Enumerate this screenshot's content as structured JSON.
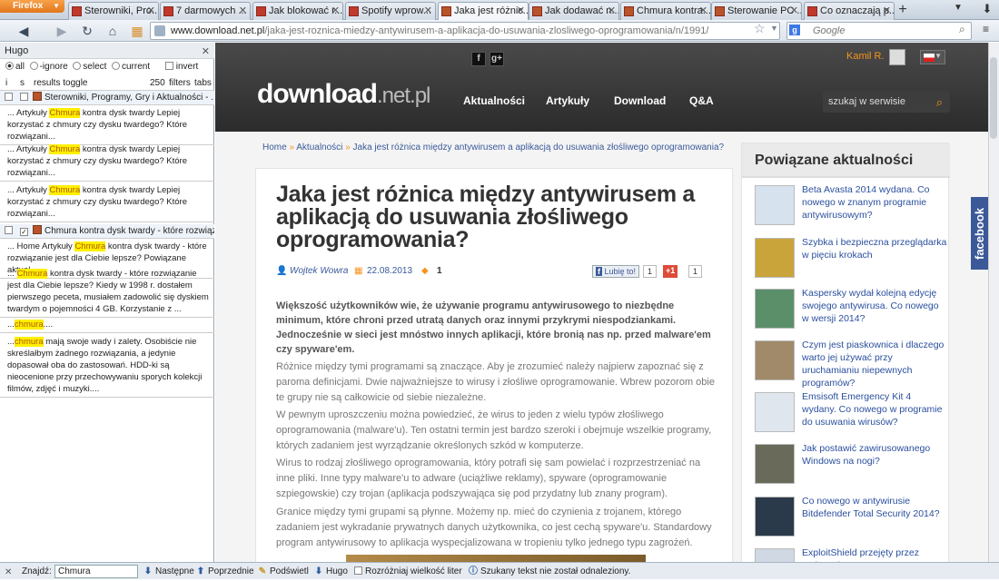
{
  "browser": {
    "menu_button": "Firefox",
    "tabs": [
      {
        "title": "Sterowniki, Pro...",
        "active": false
      },
      {
        "title": "7 darmowych ...",
        "active": false
      },
      {
        "title": "Jak blokować r...",
        "active": false
      },
      {
        "title": "Spotify wprow...",
        "active": false
      },
      {
        "title": "Jaka jest różnic...",
        "active": true
      },
      {
        "title": "Jak dodawać n...",
        "active": false
      },
      {
        "title": "Chmura kontra...",
        "active": false
      },
      {
        "title": "Sterowanie PC ...",
        "active": false
      },
      {
        "title": "Co oznaczają p...",
        "active": false
      }
    ],
    "url_domain": "www.download.net.pl",
    "url_path": "/jaka-jest-roznica-miedzy-antywirusem-a-aplikacja-do-usuwania-zlosliwego-oprogramowania/n/1991/",
    "search_placeholder": "Google"
  },
  "sidebar": {
    "title": "Hugo",
    "radios": [
      "all",
      "-ignore",
      "select",
      "current"
    ],
    "invert_label": "invert",
    "columns": {
      "i": "i",
      "s": "s",
      "toggle": "results toggle",
      "count": "250",
      "filters": "filters",
      "tabs": "tabs"
    },
    "page_rows": [
      {
        "title": "Sterowniki, Programy, Gry i Aktualności - ...",
        "checked": false
      },
      {
        "title": "Chmura kontra dysk twardy - które rozwiąz...",
        "checked": true
      }
    ],
    "results_group1": [
      {
        "before": "... Artykuły ",
        "hit": "Chmura",
        "after": " kontra dysk twardy Lepiej korzystać z chmury czy dysku twardego? Które rozwiązani..."
      },
      {
        "before": "... Artykuły ",
        "hit": "Chmura",
        "after": " kontra dysk twardy Lepiej korzystać z chmury czy dysku twardego? Które rozwiązani..."
      },
      {
        "before": "... Artykuły ",
        "hit": "Chmura",
        "after": " kontra dysk twardy Lepiej korzystać z chmury czy dysku twardego? Które rozwiązani..."
      }
    ],
    "results_group2": [
      {
        "before": "... Home Artykuły ",
        "hit": "Chmura",
        "after": " kontra dysk twardy - które rozwiązanie jest dla Ciebie lepsze? Powiązane aktual..."
      },
      {
        "before": "... ",
        "hit": "Chmura",
        "after": " kontra dysk twardy - które rozwiązanie jest dla Ciebie lepsze? Kiedy w 1998 r. dostałem pierwszego peceta, musiałem zadowolić się dyskiem twardym o pojemności 4 GB. Korzystanie z ..."
      },
      {
        "before": "...",
        "hit": "chmura",
        "after": "...."
      },
      {
        "before": "...",
        "hit": "chmura",
        "after": " mają swoje wady i zalety. Osobiście nie skreślałbym żadnego rozwiązania, a jedynie dopasował oba do zastosowań. HDD-ki są nieocenione przy przechowywaniu sporych kolekcji filmów, zdjęć i muzyki...."
      }
    ]
  },
  "site": {
    "social": [
      "f",
      "g+"
    ],
    "logo_main": "do",
    "logo_mid": "wnload",
    "logo_tld": ".net.pl",
    "nav": [
      "Aktualności",
      "Artykuły",
      "Download",
      "Q&A"
    ],
    "search_placeholder": "szukaj w serwisie",
    "user": "Kamil R.",
    "breadcrumb": [
      "Home",
      "Aktualności",
      "Jaka jest różnica między antywirusem a aplikacją do usuwania złośliwego oprogramowania?"
    ],
    "article": {
      "title": "Jaka jest różnica między antywirusem a aplikacją do usuwania złośliwego oprogramowania?",
      "author": "Wojtek Wowra",
      "date": "22.08.2013",
      "comments": "1",
      "fb_like": "Lubię to!",
      "fb_count": "1",
      "gplus": "+1",
      "gplus_count": "1",
      "lead": "Większość użytkowników wie, że używanie programu antywirusowego to niezbędne minimum, które chroni przed utratą danych oraz innymi przykrymi niespodziankami. Jednocześnie w sieci jest mnóstwo innych aplikacji, które bronią nas np. przed malware'em czy spyware'em.",
      "paragraphs": [
        "Różnice między tymi programami są znaczące. Aby je zrozumieć należy najpierw zapoznać się z paroma definicjami. Dwie najważniejsze to wirusy i złośliwe oprogramowanie. Wbrew pozorom obie te grupy nie są całkowicie od siebie niezależne.",
        "W pewnym uproszczeniu można powiedzieć, że wirus to jeden z wielu typów złośliwego oprogramowania (malware'u). Ten ostatni termin jest bardzo szeroki i obejmuje wszelkie programy, których zadaniem jest wyrządzanie określonych szkód w komputerze.",
        "Wirus to rodzaj złośliwego oprogramowania, który potrafi się sam powielać i rozprzestrzeniać na inne pliki. Inne typy malware'u to adware (uciążliwe reklamy), spyware (oprogramowanie szpiegowskie) czy trojan (aplikacja podszywająca się pod przydatny lub znany program).",
        "Granice między tymi grupami są płynne. Możemy np. mieć do czynienia z trojanem, którego zadaniem jest wykradanie prywatnych danych użytkownika, co jest cechą spyware'u. Standardowy program antywirusowy to aplikacja wyspecjalizowana w tropieniu tylko jednego typu zagrożeń."
      ]
    },
    "aside": {
      "title": "Powiązane aktualności",
      "items": [
        "Beta Avasta 2014 wydana. Co nowego w znanym programie antywirusowym?",
        "Szybka i bezpieczna przeglądarka w pięciu krokach",
        "Kaspersky wydał kolejną edycję swojego antywirusa. Co nowego w wersji 2014?",
        "Czym jest piaskownica i dlaczego warto jej używać przy uruchamianiu niepewnych programów?",
        "Emsisoft Emergency Kit 4 wydany. Co nowego w programie do usuwania wirusów?",
        "Jak postawić zawirusowanego Windows na nogi?",
        "Co nowego w antywirusie Bitdefender Total Security 2014?",
        "ExploitShield przejęty przez Malwarebytes. Co nowego..."
      ]
    },
    "fb_sidebar": "facebook"
  },
  "findbar": {
    "label": "Znajdź:",
    "value": "Chmura",
    "next": "Następne",
    "prev": "Poprzednie",
    "highlight": "Podświetl",
    "hugo": "Hugo",
    "match_case": "Rozróżniaj wielkość liter",
    "status": "Szukany tekst nie został odnaleziony."
  }
}
